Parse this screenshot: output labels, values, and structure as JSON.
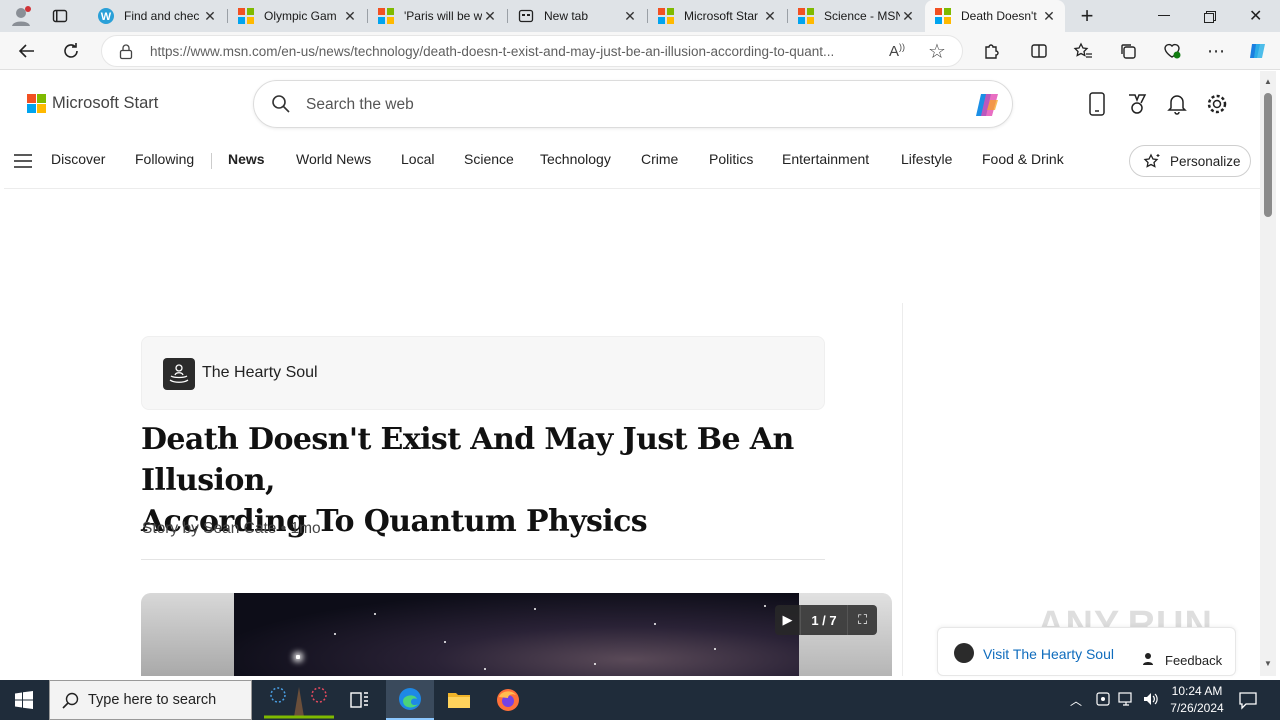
{
  "browser": {
    "tabs": [
      {
        "title": "Find and chec",
        "favicon": "w-icon",
        "active": false
      },
      {
        "title": "Olympic Gam",
        "favicon": "msn-icon",
        "active": false
      },
      {
        "title": "'Paris will be w",
        "favicon": "msn-icon",
        "active": false
      },
      {
        "title": "New tab",
        "favicon": "newtab-icon",
        "active": false
      },
      {
        "title": "Microsoft Star",
        "favicon": "msn-icon",
        "active": false
      },
      {
        "title": "Science - MSN",
        "favicon": "msn-icon",
        "active": false
      },
      {
        "title": "Death Doesn't",
        "favicon": "msn-icon",
        "active": true
      }
    ],
    "url": "https://www.msn.com/en-us/news/technology/death-doesn-t-exist-and-may-just-be-an-illusion-according-to-quant..."
  },
  "header": {
    "logo_text": "Microsoft Start",
    "search_placeholder": "Search the web"
  },
  "nav": {
    "items": [
      "Discover",
      "Following",
      "News",
      "World News",
      "Local",
      "Science",
      "Technology",
      "Crime",
      "Politics",
      "Entertainment",
      "Lifestyle",
      "Food & Drink"
    ],
    "active": "News",
    "personalize_label": "Personalize"
  },
  "article": {
    "publisher": "The Hearty Soul",
    "headline_line1": "Death Doesn't Exist And May Just Be An Illusion,",
    "headline_line2": "According To Quantum Physics",
    "byline": "Story by Sean Cate • 1mo",
    "slide_counter": "1 / 7"
  },
  "footer_bar": {
    "visit_label": "Visit The Hearty Soul",
    "feedback_label": "Feedback"
  },
  "watermark": "ANY.RUN",
  "taskbar": {
    "search_placeholder": "Type here to search",
    "time": "10:24 AM",
    "date": "7/26/2024"
  },
  "colors": {
    "ms_red": "#f25022",
    "ms_green": "#7fba00",
    "ms_blue": "#00a4ef",
    "ms_yellow": "#ffb900",
    "link_blue": "#0f6cbd",
    "taskbar": "#1f2c3a"
  }
}
